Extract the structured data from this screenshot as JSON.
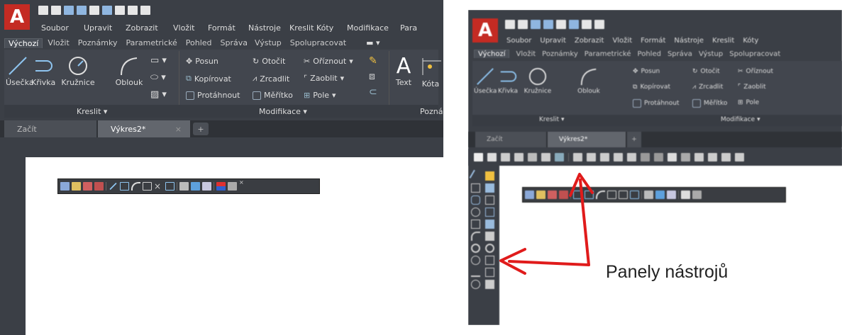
{
  "left_screenshot": {
    "app_logo_letter": "A",
    "menu_items": [
      "Soubor",
      "Upravit",
      "Zobrazit",
      "Vložit",
      "Formát",
      "Nástroje",
      "Kreslit",
      "Kóty",
      "Modifikace",
      "Para"
    ],
    "ribbon_tabs": [
      "Výchozí",
      "Vložit",
      "Poznámky",
      "Parametrické",
      "Pohled",
      "Správa",
      "Výstup",
      "Spolupracovat"
    ],
    "draw_tools": [
      "Úsečka",
      "Křivka",
      "Kružnice",
      "Oblouk"
    ],
    "modify_tools": {
      "col1": [
        "Posun",
        "Kopírovat",
        "Protáhnout"
      ],
      "col2": [
        "Otočit",
        "Zrcadlit",
        "Měřítko"
      ],
      "col3": [
        "Oříznout",
        "Zaoblit",
        "Pole"
      ]
    },
    "annotation_tools": [
      "Text",
      "Kóta"
    ],
    "panel_titles": {
      "draw": "Kreslit ▾",
      "modify": "Modifikace ▾",
      "annot": "Pozná"
    },
    "file_tabs": [
      "Začít",
      "Výkres2*"
    ],
    "close_glyph": "×",
    "new_tab_glyph": "+"
  },
  "right_screenshot": {
    "app_logo_letter": "A",
    "menu_items": [
      "Soubor",
      "Upravit",
      "Zobrazit",
      "Vložit",
      "Formát",
      "Nástroje",
      "Kreslit",
      "Kóty"
    ],
    "ribbon_tabs": [
      "Výchozí",
      "Vložit",
      "Poznámky",
      "Parametrické",
      "Pohled",
      "Správa",
      "Výstup",
      "Spolupracovat"
    ],
    "draw_tools": [
      "Úsečka",
      "Křivka",
      "Kružnice",
      "Oblouk"
    ],
    "modify_tools": {
      "col1": [
        "Posun",
        "Kopírovat",
        "Protáhnout"
      ],
      "col2": [
        "Otočit",
        "Zrcadlit",
        "Měřítko"
      ],
      "col3": [
        "Oříznout",
        "Zaoblit",
        "Pole"
      ]
    },
    "panel_titles": {
      "draw": "Kreslit ▾",
      "modify": "Modifikace ▾"
    },
    "file_tabs": [
      "Začít",
      "Výkres2*"
    ],
    "annotation": "Panely nástrojů"
  },
  "colors": {
    "ribbon_dark": "#3b3f46",
    "autocad_red": "#c42b23",
    "arrow_red": "#e01b1b"
  }
}
